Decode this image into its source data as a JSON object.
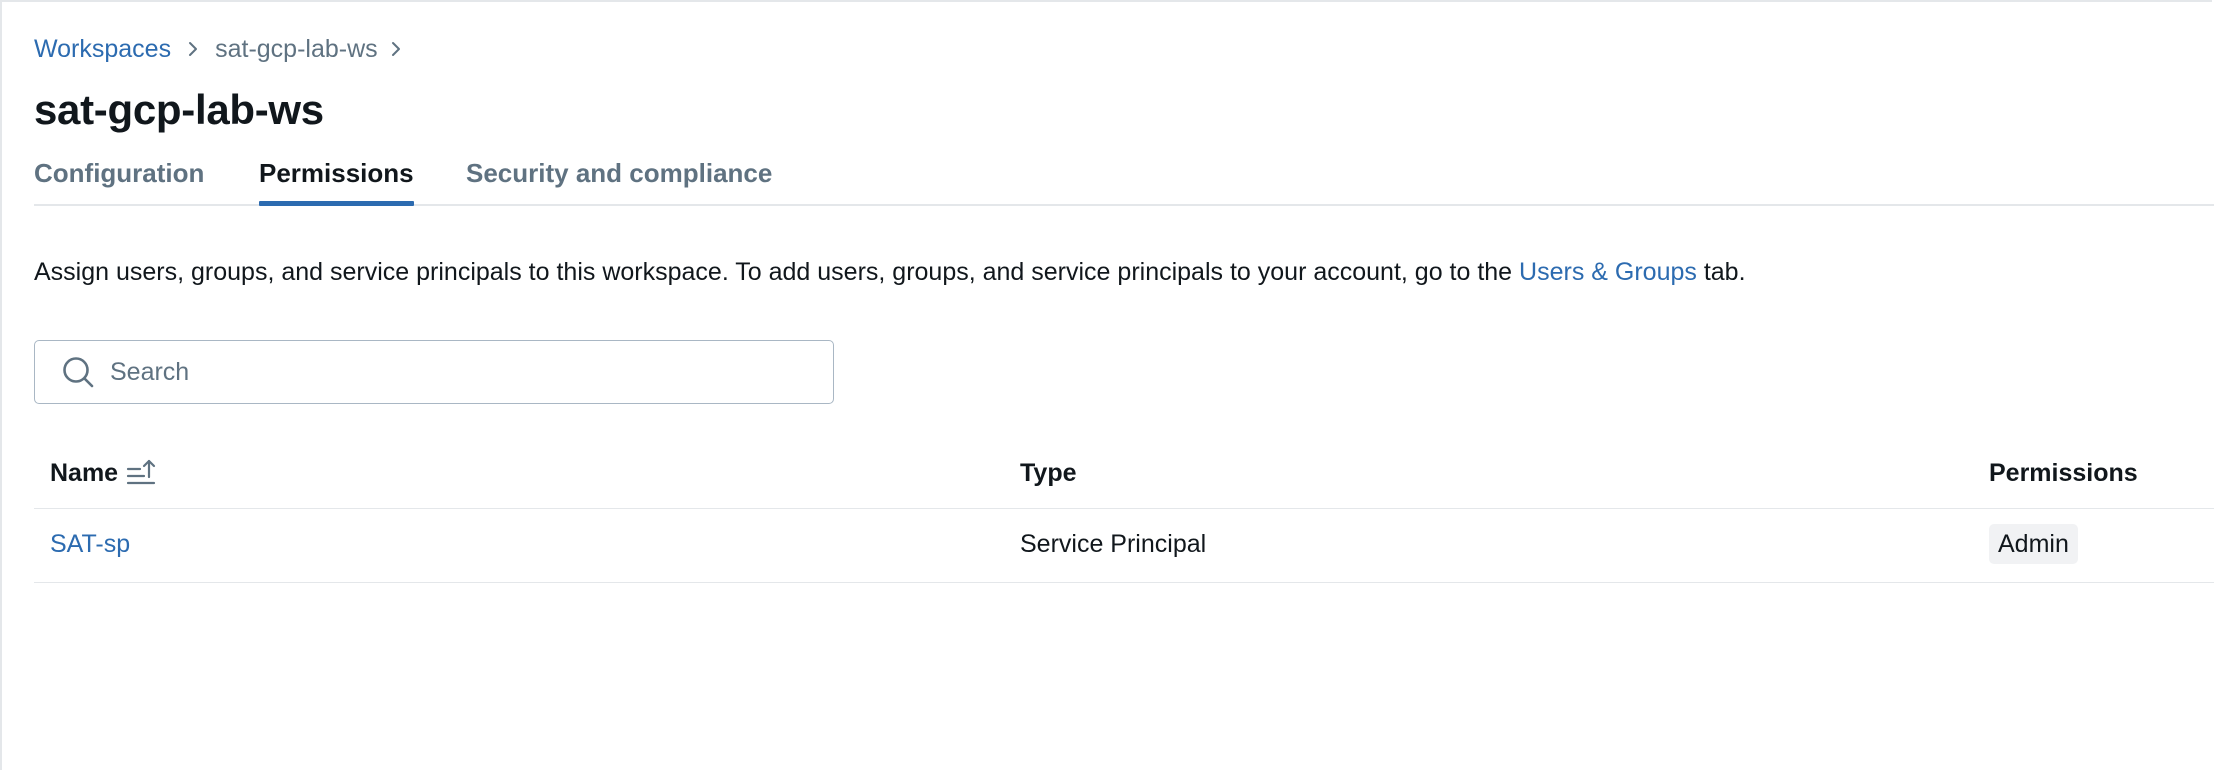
{
  "breadcrumb": {
    "items": [
      {
        "label": "Workspaces"
      },
      {
        "label": "sat-gcp-lab-ws"
      }
    ]
  },
  "page": {
    "title": "sat-gcp-lab-ws"
  },
  "tabs": [
    {
      "label": "Configuration",
      "active": false
    },
    {
      "label": "Permissions",
      "active": true
    },
    {
      "label": "Security and compliance",
      "active": false
    }
  ],
  "description": {
    "text_before": "Assign users, groups, and service principals to this workspace. To add users, groups, and service principals to your account, go to the ",
    "link": "Users & Groups",
    "text_after": " tab."
  },
  "search": {
    "placeholder": "Search",
    "value": ""
  },
  "table": {
    "columns": [
      "Name",
      "Type",
      "Permissions"
    ],
    "rows": [
      {
        "name": "SAT-sp",
        "type": "Service Principal",
        "permission": "Admin"
      }
    ]
  },
  "colors": {
    "link": "#2c6bb0",
    "text": "#11171c",
    "muted": "#5f7281",
    "border": "#e4e7ea",
    "badge_bg": "#f1f2f4"
  },
  "icons": {
    "breadcrumb_separator": "chevron-right-icon",
    "search": "search-icon",
    "sort": "sort-ascending-icon"
  }
}
